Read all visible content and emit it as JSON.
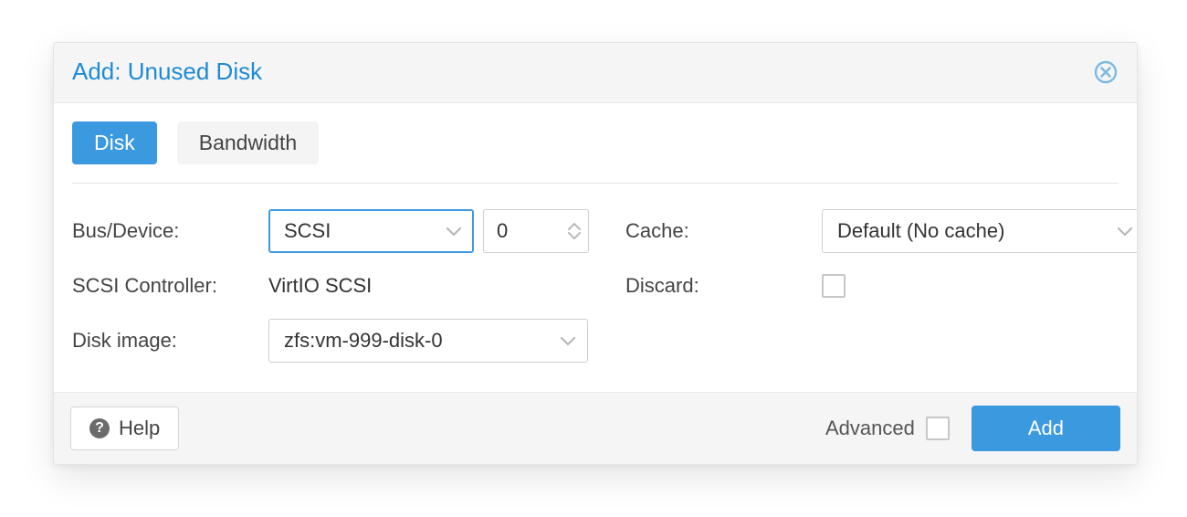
{
  "dialog": {
    "title": "Add: Unused Disk"
  },
  "tabs": {
    "disk": "Disk",
    "bandwidth": "Bandwidth"
  },
  "left": {
    "bus_device_label": "Bus/Device:",
    "bus_value": "SCSI",
    "device_number": "0",
    "scsi_controller_label": "SCSI Controller:",
    "scsi_controller_value": "VirtIO SCSI",
    "disk_image_label": "Disk image:",
    "disk_image_value": "zfs:vm-999-disk-0"
  },
  "right": {
    "cache_label": "Cache:",
    "cache_value": "Default (No cache)",
    "discard_label": "Discard:"
  },
  "footer": {
    "help": "Help",
    "advanced": "Advanced",
    "add": "Add"
  }
}
